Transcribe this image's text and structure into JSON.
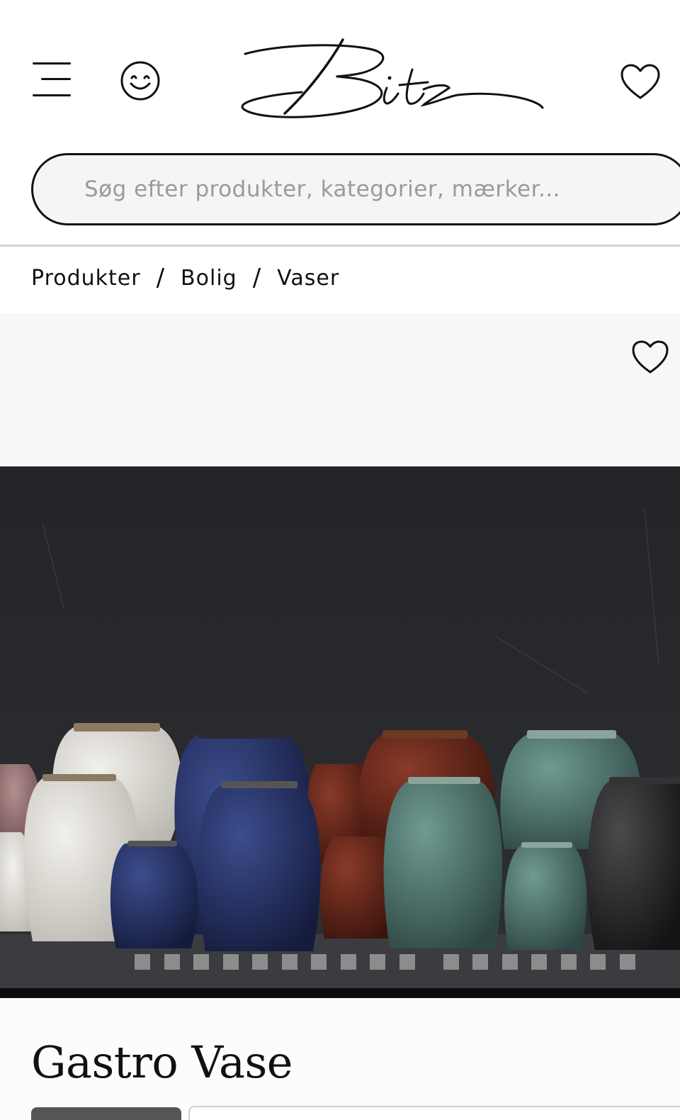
{
  "header": {
    "menu_icon": "hamburger-menu-icon",
    "account_icon": "smiley-face-icon",
    "logo_text": "Bitz",
    "wishlist_icon": "heart-outline-icon"
  },
  "search": {
    "placeholder": "Søg efter produkter, kategorier, mærker...",
    "value": ""
  },
  "breadcrumb": {
    "items": [
      "Produkter",
      "Bolig",
      "Vaser"
    ],
    "separator": "/"
  },
  "gallery": {
    "favorite_icon": "heart-outline-icon",
    "indicator_count": 18,
    "indicator_color": "#8c8c8c"
  },
  "product": {
    "title": "Gastro Vase"
  },
  "colors": {
    "background": "#ffffff",
    "text": "#111111",
    "search_bg": "#f5f5f5",
    "placeholder": "#9a9a9a",
    "gallery_bg": "#f7f7f7"
  }
}
